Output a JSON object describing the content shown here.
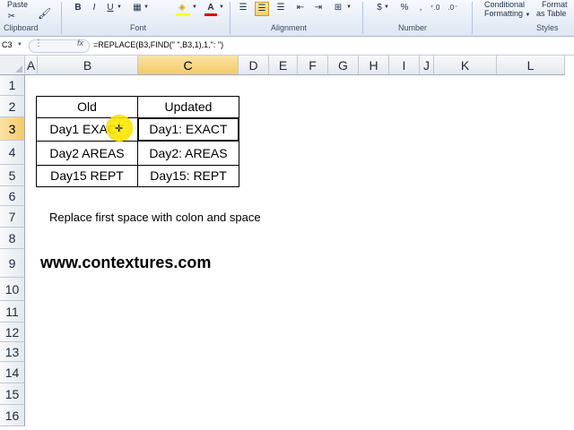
{
  "ribbon": {
    "paste_label": "Paste",
    "bold": "B",
    "italic": "I",
    "underline": "U",
    "currency": "$",
    "conditional_formatting_line1": "Conditional",
    "conditional_formatting_line2": "Formatting",
    "format_table_line1": "Format",
    "format_table_line2": "as Table",
    "groups": {
      "clipboard": "Clipboard",
      "font": "Font",
      "alignment": "Alignment",
      "number": "Number",
      "styles": "Styles"
    }
  },
  "formula_bar": {
    "name_box": "C3",
    "fx": "fx",
    "formula": "=REPLACE(B3,FIND(\" \",B3,1),1,\": \")"
  },
  "columns": [
    "A",
    "B",
    "C",
    "D",
    "E",
    "F",
    "G",
    "H",
    "I",
    "J",
    "K",
    "L"
  ],
  "rows": [
    "1",
    "2",
    "3",
    "4",
    "5",
    "6",
    "7",
    "8",
    "9",
    "10",
    "11",
    "12",
    "13",
    "14",
    "15",
    "16"
  ],
  "table": {
    "headers": [
      "Old",
      "Updated"
    ],
    "rows": [
      [
        "Day1 EXACT",
        "Day1: EXACT"
      ],
      [
        "Day2 AREAS",
        "Day2: AREAS"
      ],
      [
        "Day15 REPT",
        "Day15: REPT"
      ]
    ]
  },
  "note": "Replace first space with colon and space",
  "website": "www.contextures.com",
  "colors": {
    "selection": "#f5c96a",
    "ribbon": "#dde6f2"
  }
}
